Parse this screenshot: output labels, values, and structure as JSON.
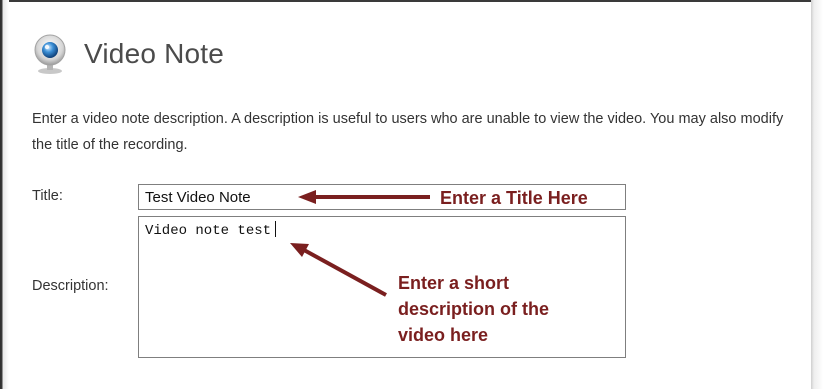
{
  "header": {
    "title": "Video Note",
    "icon": "webcam-icon"
  },
  "intro": {
    "text": "Enter a video note description. A description is useful to users who are unable to view the video. You may also modify the title of the recording."
  },
  "form": {
    "title_label": "Title:",
    "title_value": "Test Video Note",
    "description_label": "Description:",
    "description_value": "Video note test"
  },
  "annotations": {
    "title_callout": "Enter a Title Here",
    "description_callout_lines": [
      "Enter a short",
      "description of the",
      "video here"
    ],
    "color": "#7a1f1f"
  }
}
